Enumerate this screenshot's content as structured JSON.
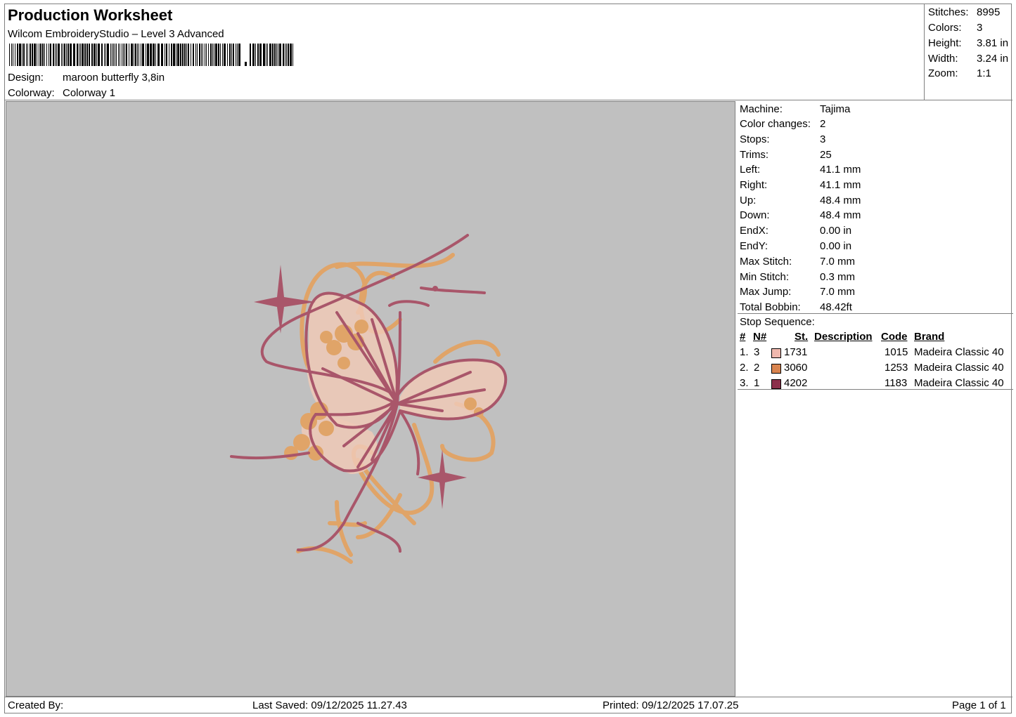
{
  "header": {
    "title": "Production Worksheet",
    "software": "Wilcom EmbroideryStudio – Level 3 Advanced",
    "design_label": "Design:",
    "design_value": "maroon butterfly 3,8in",
    "colorway_label": "Colorway:",
    "colorway_value": "Colorway 1"
  },
  "stats": [
    {
      "label": "Stitches:",
      "value": "8995"
    },
    {
      "label": "Colors:",
      "value": "3"
    },
    {
      "label": "Height:",
      "value": "3.81 in"
    },
    {
      "label": "Width:",
      "value": "3.24 in"
    },
    {
      "label": "Zoom:",
      "value": "1:1"
    }
  ],
  "params": [
    {
      "label": "Machine:",
      "value": "Tajima"
    },
    {
      "label": "Color changes:",
      "value": "2"
    },
    {
      "label": "Stops:",
      "value": "3"
    },
    {
      "label": "Trims:",
      "value": "25"
    },
    {
      "label": "Left:",
      "value": "41.1 mm"
    },
    {
      "label": "Right:",
      "value": "41.1 mm"
    },
    {
      "label": "Up:",
      "value": "48.4 mm"
    },
    {
      "label": "Down:",
      "value": "48.4 mm"
    },
    {
      "label": "EndX:",
      "value": "0.00 in"
    },
    {
      "label": "EndY:",
      "value": "0.00 in"
    },
    {
      "label": "Max Stitch:",
      "value": "7.0 mm"
    },
    {
      "label": "Min Stitch:",
      "value": "0.3 mm"
    },
    {
      "label": "Max Jump:",
      "value": "7.0 mm"
    },
    {
      "label": "Total Bobbin:",
      "value": "48.42ft"
    }
  ],
  "stop_sequence": {
    "title": "Stop Sequence:",
    "headers": {
      "num": "#",
      "needle": "N#",
      "st": "St.",
      "description": "Description",
      "code": "Code",
      "brand": "Brand"
    },
    "rows": [
      {
        "num": "1.",
        "needle": "3",
        "color": "#f0b8ae",
        "st": "1731",
        "code": "1015",
        "brand": "Madeira Classic 40"
      },
      {
        "num": "2.",
        "needle": "2",
        "color": "#d9844f",
        "st": "3060",
        "code": "1253",
        "brand": "Madeira Classic 40"
      },
      {
        "num": "3.",
        "needle": "1",
        "color": "#8c2f4b",
        "st": "4202",
        "code": "1183",
        "brand": "Madeira Classic 40"
      }
    ]
  },
  "footer": {
    "created_by": "Created By:",
    "last_saved": "Last Saved: 09/12/2025 11.27.43",
    "printed": "Printed: 09/12/2025 17.07.25",
    "page": "Page 1 of 1"
  },
  "colors": {
    "canvas_bg": "#c0c0c0",
    "maroon_thread": "#a9566a",
    "tan_thread": "#e0a468",
    "pink_fill": "#efc9b6"
  }
}
